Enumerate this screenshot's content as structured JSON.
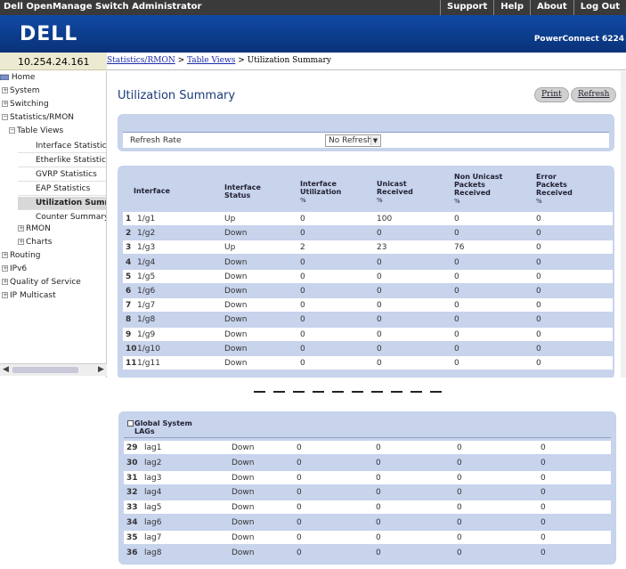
{
  "app": {
    "title": "Dell OpenManage Switch Administrator",
    "links": [
      "Support",
      "Help",
      "About",
      "Log Out"
    ],
    "logo": "DELL",
    "product": "PowerConnect 6224"
  },
  "ip": "10.254.24.161",
  "breadcrumb": {
    "part1": "Statistics/RMON",
    "sep1": " > ",
    "part2": "Table Views",
    "sep2": " > ",
    "current": "Utilization Summary"
  },
  "sidebar": {
    "home": "Home",
    "system": "System",
    "switching": "Switching",
    "statistics": "Statistics/RMON",
    "table_views": "Table Views",
    "interface_stats": "Interface Statistics",
    "etherlike_stats": "Etherlike Statistics",
    "gvrp_stats": "GVRP Statistics",
    "eap_stats": "EAP Statistics",
    "util_summary": "Utilization Summa",
    "counter_summary": "Counter Summary",
    "rmon": "RMON",
    "charts": "Charts",
    "routing": "Routing",
    "ipv6": "IPv6",
    "qos": "Quality of Service",
    "ip_multicast": "IP Multicast"
  },
  "page": {
    "title": "Utilization Summary",
    "print_label": "Print",
    "refresh_label": "Refresh",
    "refresh_rate_label": "Refresh Rate",
    "refresh_rate_value": "No Refresh"
  },
  "table": {
    "headers": {
      "interface": "Interface",
      "status_1": "Interface",
      "status_2": "Status",
      "util_1": "Interface",
      "util_2": "Utilization",
      "util_pct": "%",
      "unicast_1": "Unicast",
      "unicast_2": "Received",
      "unicast_pct": "%",
      "nonuni_1": "Non Unicast",
      "nonuni_2": "Packets",
      "nonuni_3": "Received",
      "nonuni_pct": "%",
      "error_1": "Error",
      "error_2": "Packets",
      "error_3": "Received",
      "error_pct": "%"
    },
    "rows": [
      {
        "idx": "1",
        "iface": "1/g1",
        "status": "Up",
        "util": "0",
        "unicast": "100",
        "nonuni": "0",
        "error": "0"
      },
      {
        "idx": "2",
        "iface": "1/g2",
        "status": "Down",
        "util": "0",
        "unicast": "0",
        "nonuni": "0",
        "error": "0"
      },
      {
        "idx": "3",
        "iface": "1/g3",
        "status": "Up",
        "util": "2",
        "unicast": "23",
        "nonuni": "76",
        "error": "0"
      },
      {
        "idx": "4",
        "iface": "1/g4",
        "status": "Down",
        "util": "0",
        "unicast": "0",
        "nonuni": "0",
        "error": "0"
      },
      {
        "idx": "5",
        "iface": "1/g5",
        "status": "Down",
        "util": "0",
        "unicast": "0",
        "nonuni": "0",
        "error": "0"
      },
      {
        "idx": "6",
        "iface": "1/g6",
        "status": "Down",
        "util": "0",
        "unicast": "0",
        "nonuni": "0",
        "error": "0"
      },
      {
        "idx": "7",
        "iface": "1/g7",
        "status": "Down",
        "util": "0",
        "unicast": "0",
        "nonuni": "0",
        "error": "0"
      },
      {
        "idx": "8",
        "iface": "1/g8",
        "status": "Down",
        "util": "0",
        "unicast": "0",
        "nonuni": "0",
        "error": "0"
      },
      {
        "idx": "9",
        "iface": "1/g9",
        "status": "Down",
        "util": "0",
        "unicast": "0",
        "nonuni": "0",
        "error": "0"
      },
      {
        "idx": "10",
        "iface": "1/g10",
        "status": "Down",
        "util": "0",
        "unicast": "0",
        "nonuni": "0",
        "error": "0"
      },
      {
        "idx": "11",
        "iface": "1/g11",
        "status": "Down",
        "util": "0",
        "unicast": "0",
        "nonuni": "0",
        "error": "0"
      }
    ]
  },
  "lags": {
    "header_1": "Global System",
    "header_2": "LAGs",
    "rows": [
      {
        "idx": "29",
        "iface": "lag1",
        "status": "Down",
        "util": "0",
        "unicast": "0",
        "nonuni": "0",
        "error": "0"
      },
      {
        "idx": "30",
        "iface": "lag2",
        "status": "Down",
        "util": "0",
        "unicast": "0",
        "nonuni": "0",
        "error": "0"
      },
      {
        "idx": "31",
        "iface": "lag3",
        "status": "Down",
        "util": "0",
        "unicast": "0",
        "nonuni": "0",
        "error": "0"
      },
      {
        "idx": "32",
        "iface": "lag4",
        "status": "Down",
        "util": "0",
        "unicast": "0",
        "nonuni": "0",
        "error": "0"
      },
      {
        "idx": "33",
        "iface": "lag5",
        "status": "Down",
        "util": "0",
        "unicast": "0",
        "nonuni": "0",
        "error": "0"
      },
      {
        "idx": "34",
        "iface": "lag6",
        "status": "Down",
        "util": "0",
        "unicast": "0",
        "nonuni": "0",
        "error": "0"
      },
      {
        "idx": "35",
        "iface": "lag7",
        "status": "Down",
        "util": "0",
        "unicast": "0",
        "nonuni": "0",
        "error": "0"
      },
      {
        "idx": "36",
        "iface": "lag8",
        "status": "Down",
        "util": "0",
        "unicast": "0",
        "nonuni": "0",
        "error": "0"
      }
    ]
  }
}
